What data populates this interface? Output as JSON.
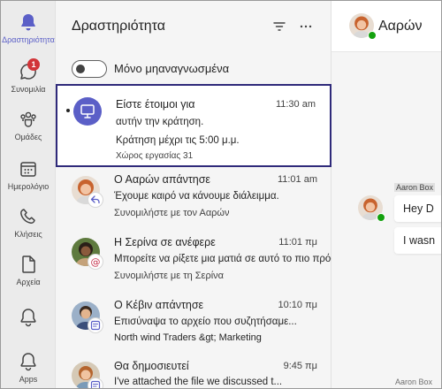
{
  "rail": {
    "items": [
      {
        "label": "Δραστηριότητα",
        "icon": "bell-icon",
        "active": true
      },
      {
        "label": "Συνομιλία",
        "icon": "chat-icon",
        "badge": "1"
      },
      {
        "label": "Ομάδες",
        "icon": "teams-icon"
      },
      {
        "label": "Ημερολόγιο",
        "icon": "calendar-icon"
      },
      {
        "label": "Κλήσεις",
        "icon": "phone-icon"
      },
      {
        "label": "Αρχεία",
        "icon": "file-icon"
      },
      {
        "label": "",
        "icon": "bell-icon"
      },
      {
        "label": "Apps",
        "icon": "apps-icon"
      }
    ]
  },
  "activity": {
    "title": "Δραστηριότητα",
    "toggle_label": "Μόνο μηαναγνωσμένα",
    "items": [
      {
        "title": "Είστε έτοιμοι για",
        "time": "11:30 am",
        "line1": "αυτήν την κράτηση.",
        "line2": "Κράτηση μέχρι τις 5:00 μ.μ.",
        "line3": "Χώρος εργασίας 31"
      },
      {
        "title": "Ο Ααρών απάντησε",
        "time": "11:01 am",
        "line1": "Έχουμε καιρό να κάνουμε διάλειμμα.",
        "line2": "Συνομιλήστε με τον Ααρών"
      },
      {
        "title": "Η Σερίνα σε ανέφερε",
        "time": "11:01 πμ",
        "line1": "Μπορείτε να ρίξετε μια ματιά σε αυτό το πιο πρόσφατο αρχείο αρχείων;",
        "line2": "Συνομιλήστε με τη Σερίνα"
      },
      {
        "title": "Ο Κέβιν απάντησε",
        "time": "10:10 πμ",
        "line1": "Επισύναψα το αρχείο που συζητήσαμε...",
        "line2": "North wind Traders &gt; Marketing"
      },
      {
        "title": "Θα δημοσιευτεί",
        "time": "9:45 πμ",
        "line1": "I've attached the file we discussed t..."
      }
    ]
  },
  "chat": {
    "name": "Ααρών",
    "sender": "Aaron Box",
    "bubble1": "Hey D",
    "bubble2": "I wasn",
    "footer_sender": "Aaron Box"
  },
  "colors": {
    "brand": "#5b5fc7",
    "selected_border": "#2f2a7a",
    "badge_red": "#d13438",
    "presence_green": "#13a10e"
  }
}
